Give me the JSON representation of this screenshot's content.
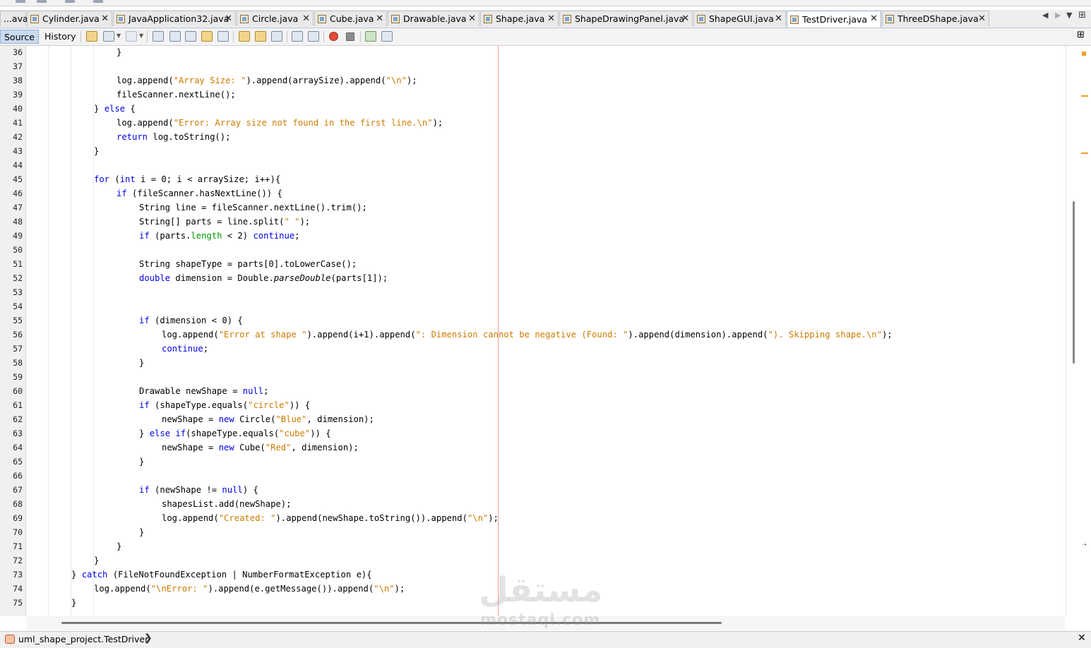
{
  "tabs": [
    {
      "label": "...ava",
      "active": false,
      "closable": false
    },
    {
      "label": "Cylinder.java",
      "active": false,
      "closable": true
    },
    {
      "label": "JavaApplication32.java",
      "active": false,
      "closable": true
    },
    {
      "label": "Circle.java",
      "active": false,
      "closable": true
    },
    {
      "label": "Cube.java",
      "active": false,
      "closable": true
    },
    {
      "label": "Drawable.java",
      "active": false,
      "closable": true
    },
    {
      "label": "Shape.java",
      "active": false,
      "closable": true
    },
    {
      "label": "ShapeDrawingPanel.java",
      "active": false,
      "closable": true
    },
    {
      "label": "ShapeGUI.java",
      "active": false,
      "closable": true
    },
    {
      "label": "TestDriver.java",
      "active": true,
      "closable": true
    },
    {
      "label": "ThreeDShape.java",
      "active": false,
      "closable": true
    }
  ],
  "tab_nav": {
    "prev": "◀",
    "next": "▶",
    "menu": "▼",
    "maximize": "⊞"
  },
  "close_glyph": "✕",
  "toolbar": {
    "source_label": "Source",
    "history_label": "History"
  },
  "editor": {
    "lines": [
      {
        "n": "36",
        "indent": 8,
        "t": [
          [
            "p",
            "}"
          ]
        ]
      },
      {
        "n": "37",
        "indent": 0,
        "t": []
      },
      {
        "n": "38",
        "indent": 8,
        "t": [
          [
            "p",
            "log.append("
          ],
          [
            "s",
            "\"Array Size: \""
          ],
          [
            "p",
            ").append(arraySize).append("
          ],
          [
            "s",
            "\"\\n\""
          ],
          [
            "p",
            ");"
          ]
        ]
      },
      {
        "n": "39",
        "indent": 8,
        "t": [
          [
            "p",
            "fileScanner.nextLine();"
          ]
        ]
      },
      {
        "n": "40",
        "indent": 6,
        "t": [
          [
            "p",
            "} "
          ],
          [
            "k",
            "else"
          ],
          [
            "p",
            " {"
          ]
        ]
      },
      {
        "n": "41",
        "indent": 8,
        "t": [
          [
            "p",
            "log.append("
          ],
          [
            "s",
            "\"Error: Array size not found in the first line.\\n\""
          ],
          [
            "p",
            ");"
          ]
        ]
      },
      {
        "n": "42",
        "indent": 8,
        "t": [
          [
            "k",
            "return"
          ],
          [
            "p",
            " log.toString();"
          ]
        ]
      },
      {
        "n": "43",
        "indent": 6,
        "t": [
          [
            "p",
            "}"
          ]
        ]
      },
      {
        "n": "44",
        "indent": 0,
        "t": []
      },
      {
        "n": "45",
        "indent": 6,
        "t": [
          [
            "k",
            "for"
          ],
          [
            "p",
            " ("
          ],
          [
            "k",
            "int"
          ],
          [
            "p",
            " i = 0; i < arraySize; i++){"
          ]
        ]
      },
      {
        "n": "46",
        "indent": 8,
        "t": [
          [
            "k",
            "if"
          ],
          [
            "p",
            " (fileScanner.hasNextLine()) {"
          ]
        ]
      },
      {
        "n": "47",
        "indent": 10,
        "t": [
          [
            "p",
            "String line = fileScanner.nextLine().trim();"
          ]
        ]
      },
      {
        "n": "48",
        "indent": 10,
        "t": [
          [
            "p",
            "String[] parts = line.split("
          ],
          [
            "s",
            "\" \""
          ],
          [
            "p",
            ");"
          ]
        ]
      },
      {
        "n": "49",
        "indent": 10,
        "t": [
          [
            "k",
            "if"
          ],
          [
            "p",
            " (parts."
          ],
          [
            "f",
            "length"
          ],
          [
            "p",
            " < 2) "
          ],
          [
            "k",
            "continue"
          ],
          [
            "p",
            ";"
          ]
        ]
      },
      {
        "n": "50",
        "indent": 0,
        "t": []
      },
      {
        "n": "51",
        "indent": 10,
        "t": [
          [
            "p",
            "String shapeType = parts[0].toLowerCase();"
          ]
        ]
      },
      {
        "n": "52",
        "indent": 10,
        "t": [
          [
            "k",
            "double"
          ],
          [
            "p",
            " dimension = Double."
          ],
          [
            "i",
            "parseDouble"
          ],
          [
            "p",
            "(parts[1]);"
          ]
        ]
      },
      {
        "n": "53",
        "indent": 0,
        "t": []
      },
      {
        "n": "54",
        "indent": 0,
        "t": []
      },
      {
        "n": "55",
        "indent": 10,
        "t": [
          [
            "k",
            "if"
          ],
          [
            "p",
            " (dimension < 0) {"
          ]
        ]
      },
      {
        "n": "56",
        "indent": 12,
        "t": [
          [
            "p",
            "log.append("
          ],
          [
            "s",
            "\"Error at shape \""
          ],
          [
            "p",
            ").append(i+1).append("
          ],
          [
            "s",
            "\": Dimension cannot be negative (Found: \""
          ],
          [
            "p",
            ").append(dimension).append("
          ],
          [
            "s",
            "\"). Skipping shape.\\n\""
          ],
          [
            "p",
            ");"
          ]
        ]
      },
      {
        "n": "57",
        "indent": 12,
        "t": [
          [
            "k",
            "continue"
          ],
          [
            "p",
            ";"
          ]
        ]
      },
      {
        "n": "58",
        "indent": 10,
        "t": [
          [
            "p",
            "}"
          ]
        ]
      },
      {
        "n": "59",
        "indent": 0,
        "t": []
      },
      {
        "n": "60",
        "indent": 10,
        "t": [
          [
            "p",
            "Drawable newShape = "
          ],
          [
            "k",
            "null"
          ],
          [
            "p",
            ";"
          ]
        ]
      },
      {
        "n": "61",
        "indent": 10,
        "t": [
          [
            "k",
            "if"
          ],
          [
            "p",
            " (shapeType.equals("
          ],
          [
            "s",
            "\"circle\""
          ],
          [
            "p",
            ")) {"
          ]
        ]
      },
      {
        "n": "62",
        "indent": 12,
        "t": [
          [
            "p",
            "newShape = "
          ],
          [
            "k",
            "new"
          ],
          [
            "p",
            " Circle("
          ],
          [
            "s",
            "\"Blue\""
          ],
          [
            "p",
            ", dimension);"
          ]
        ]
      },
      {
        "n": "63",
        "indent": 10,
        "t": [
          [
            "p",
            "} "
          ],
          [
            "k",
            "else"
          ],
          [
            "p",
            " "
          ],
          [
            "k",
            "if"
          ],
          [
            "p",
            "(shapeType.equals("
          ],
          [
            "s",
            "\"cube\""
          ],
          [
            "p",
            ")) {"
          ]
        ]
      },
      {
        "n": "64",
        "indent": 12,
        "t": [
          [
            "p",
            "newShape = "
          ],
          [
            "k",
            "new"
          ],
          [
            "p",
            " Cube("
          ],
          [
            "s",
            "\"Red\""
          ],
          [
            "p",
            ", dimension);"
          ]
        ]
      },
      {
        "n": "65",
        "indent": 10,
        "t": [
          [
            "p",
            "}"
          ]
        ]
      },
      {
        "n": "66",
        "indent": 0,
        "t": []
      },
      {
        "n": "67",
        "indent": 10,
        "t": [
          [
            "k",
            "if"
          ],
          [
            "p",
            " (newShape != "
          ],
          [
            "k",
            "null"
          ],
          [
            "p",
            ") {"
          ]
        ]
      },
      {
        "n": "68",
        "indent": 12,
        "t": [
          [
            "p",
            "shapesList.add(newShape);"
          ]
        ]
      },
      {
        "n": "69",
        "indent": 12,
        "t": [
          [
            "p",
            "log.append("
          ],
          [
            "s",
            "\"Created: \""
          ],
          [
            "p",
            ").append(newShape.toString()).append("
          ],
          [
            "s",
            "\"\\n\""
          ],
          [
            "p",
            ");"
          ]
        ]
      },
      {
        "n": "70",
        "indent": 10,
        "t": [
          [
            "p",
            "}"
          ]
        ]
      },
      {
        "n": "71",
        "indent": 8,
        "t": [
          [
            "p",
            "}"
          ]
        ]
      },
      {
        "n": "72",
        "indent": 6,
        "t": [
          [
            "p",
            "}"
          ]
        ]
      },
      {
        "n": "73",
        "indent": 4,
        "t": [
          [
            "p",
            "} "
          ],
          [
            "k",
            "catch"
          ],
          [
            "p",
            " (FileNotFoundException | NumberFormatException e){"
          ]
        ]
      },
      {
        "n": "74",
        "indent": 6,
        "t": [
          [
            "p",
            "log.append("
          ],
          [
            "s",
            "\"\\nError: \""
          ],
          [
            "p",
            ").append(e.getMessage()).append("
          ],
          [
            "s",
            "\"\\n\""
          ],
          [
            "p",
            ");"
          ]
        ]
      },
      {
        "n": "75",
        "indent": 4,
        "t": [
          [
            "p",
            "}"
          ]
        ]
      }
    ]
  },
  "statusbar": {
    "breadcrumb": "uml_shape_project.TestDriver",
    "chevron": "❯",
    "close": "✕"
  },
  "watermark": {
    "arabic": "مستقل",
    "latin": "mostaql.com"
  },
  "colors": {
    "keyword": "#0000e6",
    "string": "#ce7b00",
    "field": "#009900",
    "margin_line": "#f0a0a0"
  }
}
